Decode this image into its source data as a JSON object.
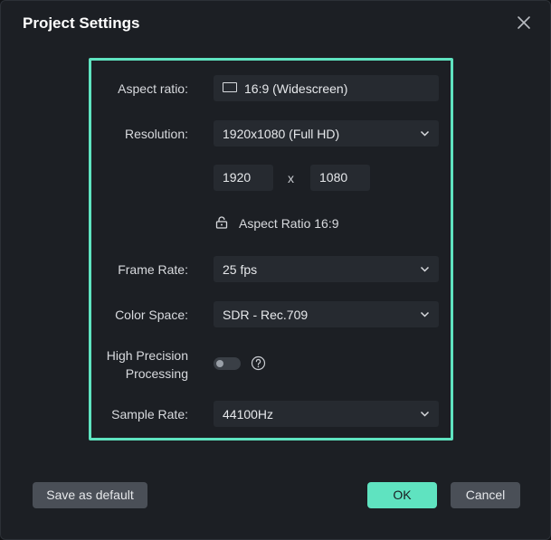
{
  "dialog": {
    "title": "Project Settings",
    "close_icon": "close-icon"
  },
  "settings": {
    "aspect_ratio": {
      "label": "Aspect ratio:",
      "value": "16:9 (Widescreen)",
      "icon": "screen-icon"
    },
    "resolution": {
      "label": "Resolution:",
      "value": "1920x1080 (Full HD)"
    },
    "dimensions": {
      "width": "1920",
      "separator": "x",
      "height": "1080",
      "lock_label": "Aspect Ratio 16:9",
      "lock_icon": "lock-icon"
    },
    "frame_rate": {
      "label": "Frame Rate:",
      "value": "25 fps"
    },
    "color_space": {
      "label": "Color Space:",
      "value": "SDR - Rec.709"
    },
    "high_precision": {
      "label_line1": "High Precision",
      "label_line2": "Processing",
      "enabled": false,
      "help_icon": "help-icon"
    },
    "sample_rate": {
      "label": "Sample Rate:",
      "value": "44100Hz"
    }
  },
  "buttons": {
    "save_default": "Save as default",
    "ok": "OK",
    "cancel": "Cancel"
  },
  "colors": {
    "accent": "#5fe3c0",
    "background": "#1c1f24",
    "field": "#262a30",
    "button": "#4a4f57"
  }
}
